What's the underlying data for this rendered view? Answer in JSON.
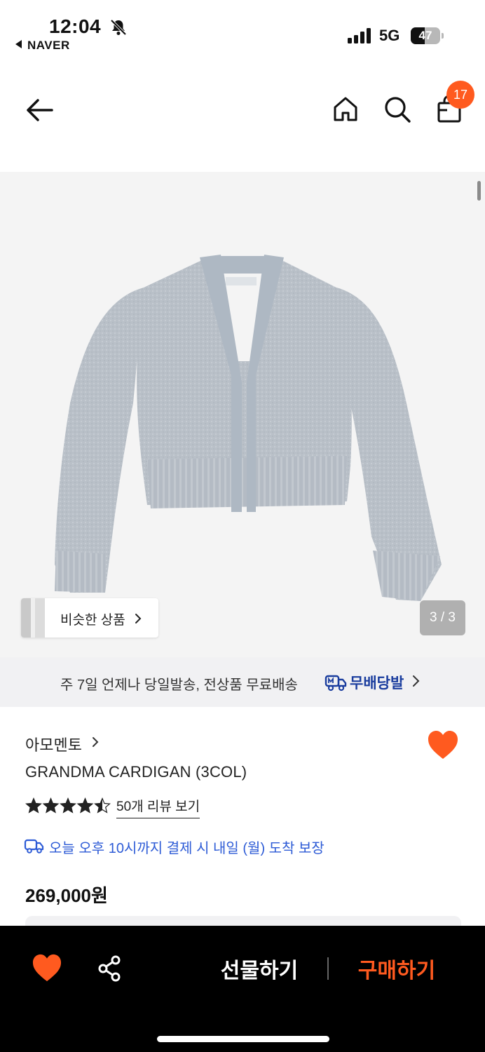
{
  "status_bar": {
    "time": "12:04",
    "back_app": "NAVER",
    "network": "5G",
    "battery": "47",
    "battery_level": 0.47
  },
  "nav": {
    "cart_count": "17"
  },
  "gallery": {
    "similar_label": "비슷한 상품",
    "page_indicator": "3 / 3"
  },
  "shipping": {
    "text": "주 7일 언제나 당일발송, 전상품 무료배송",
    "badge": "무배당발"
  },
  "product": {
    "brand": "아모멘토",
    "title": "GRANDMA CARDIGAN (3COL)",
    "rating": 4.5,
    "review_link": "50개 리뷰 보기",
    "delivery": "오늘 오후 10시까지 결제 시 내일 (월) 도착 보장",
    "price": "269,000원"
  },
  "bottom_bar": {
    "gift_label": "선물하기",
    "buy_label": "구매하기"
  },
  "colors": {
    "accent": "#ff5a1f",
    "delivery_blue": "#2d5bd6",
    "badge_navy": "#1a3d9e"
  }
}
